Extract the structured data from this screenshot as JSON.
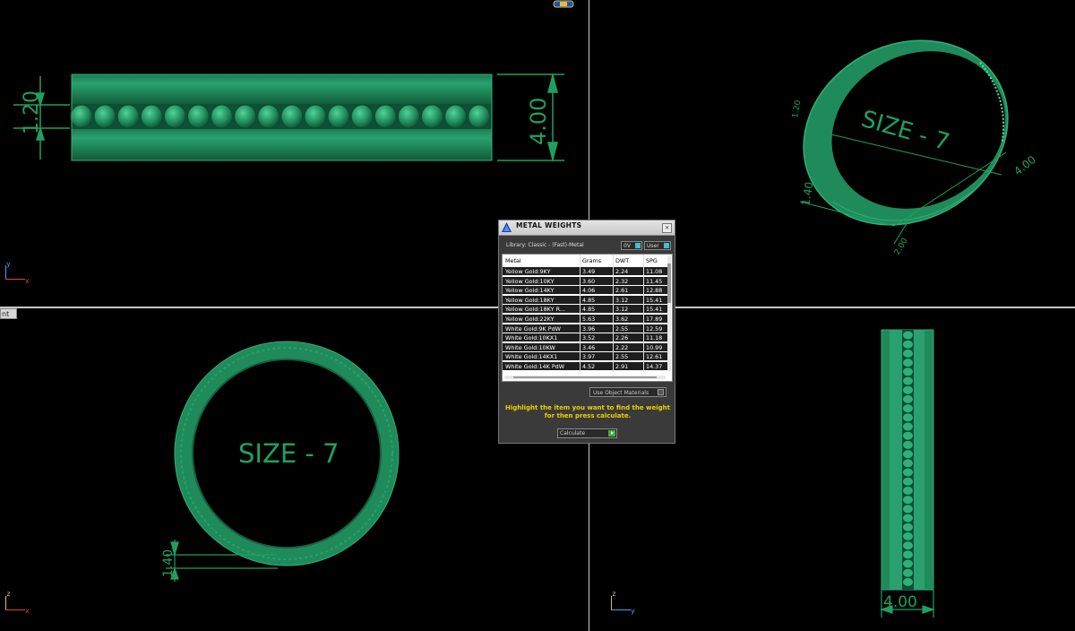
{
  "viewports": {
    "top_left": {
      "dimension_height_left": "1.20",
      "dimension_height_right": "4.00",
      "axis_labels": {
        "vertical": "y",
        "horizontal": "x"
      }
    },
    "top_right": {
      "size_label": "SIZE - 7",
      "dim_a": "4.00",
      "dim_b": "1.40",
      "dim_c": "1.20",
      "dim_d": "2.00"
    },
    "bottom_left": {
      "size_label": "SIZE - 7",
      "dim_thickness": "1.40",
      "axis_labels": {
        "vertical": "z",
        "horizontal": "x"
      },
      "view_label": "nt"
    },
    "bottom_right": {
      "dim_width": "4.00",
      "axis_labels": {
        "vertical": "z",
        "horizontal": "y"
      }
    }
  },
  "dialog": {
    "title": "METAL WEIGHTS",
    "close_glyph": "×",
    "library": "Library: Classic - (Fast)-Metal",
    "btn_0v": "0V",
    "btn_user": "User",
    "columns": [
      "Metal",
      "Grams",
      "DWT",
      "SPG"
    ],
    "rows": [
      {
        "metal": "Yellow Gold:9KY",
        "grams": "3.49",
        "dwt": "2.24",
        "spg": "11.08"
      },
      {
        "metal": "Yellow Gold:10KY",
        "grams": "3.60",
        "dwt": "2.32",
        "spg": "11.45"
      },
      {
        "metal": "Yellow Gold:14KY",
        "grams": "4.06",
        "dwt": "2.61",
        "spg": "12.88"
      },
      {
        "metal": "Yellow Gold:18KY",
        "grams": "4.85",
        "dwt": "3.12",
        "spg": "15.41"
      },
      {
        "metal": "Yellow Gold:18KY R...",
        "grams": "4.85",
        "dwt": "3.12",
        "spg": "15.41"
      },
      {
        "metal": "Yellow Gold:22KY",
        "grams": "5.63",
        "dwt": "3.62",
        "spg": "17.89"
      },
      {
        "metal": "White Gold:9K PdW",
        "grams": "3.96",
        "dwt": "2.55",
        "spg": "12.59"
      },
      {
        "metal": "White Gold:10KX1",
        "grams": "3.52",
        "dwt": "2.26",
        "spg": "11.18"
      },
      {
        "metal": "White Gold:10KW",
        "grams": "3.46",
        "dwt": "2.22",
        "spg": "10.99"
      },
      {
        "metal": "White Gold:14KX1",
        "grams": "3.97",
        "dwt": "2.55",
        "spg": "12.61"
      },
      {
        "metal": "White Gold:14K PdW",
        "grams": "4.52",
        "dwt": "2.91",
        "spg": "14.37"
      }
    ],
    "use_object_materials": "Use Object Materials",
    "instruction_line1": "Highlight the item you want to find the weight",
    "instruction_line2": "for then press calculate.",
    "calculate": "Calculate"
  },
  "colors": {
    "ring": "#1f8a5a",
    "ring_highlight": "#2fb07a",
    "ring_shadow": "#136040",
    "dimension": "#1fa060",
    "background": "#000000",
    "instruction": "#f0d000"
  }
}
